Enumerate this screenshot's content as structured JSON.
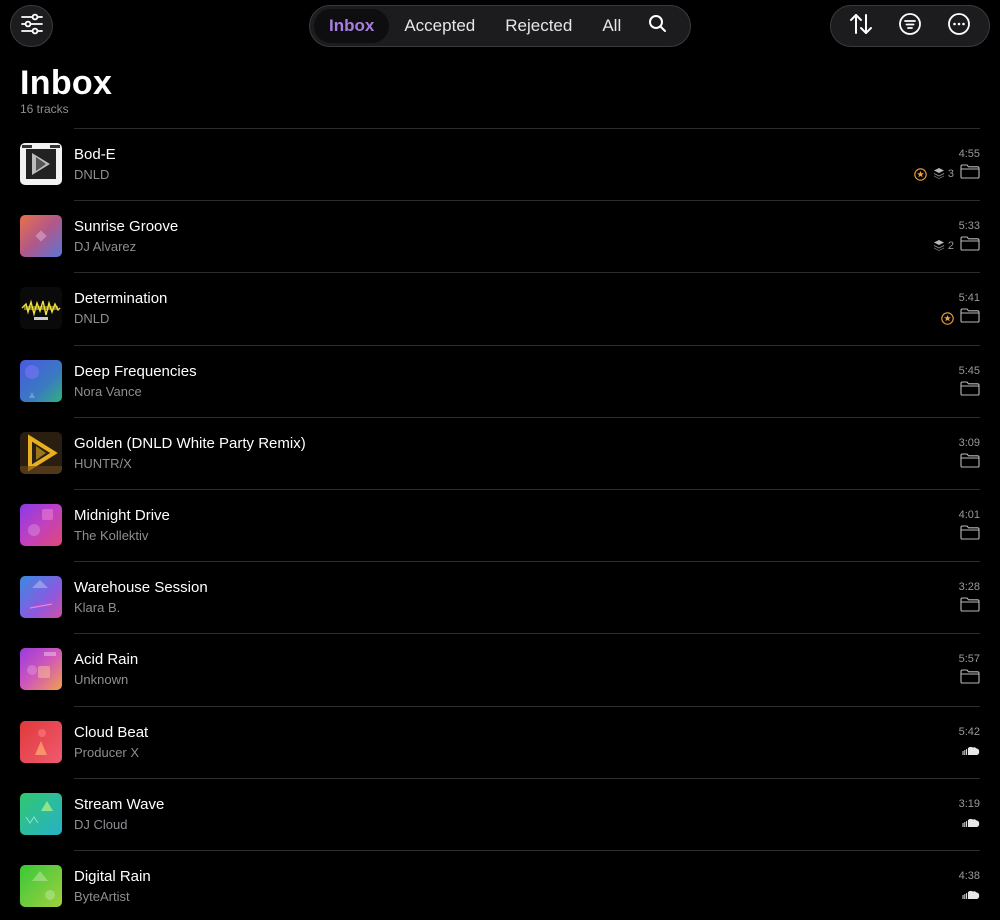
{
  "nav": {
    "tabs": [
      {
        "label": "Inbox",
        "active": true
      },
      {
        "label": "Accepted",
        "active": false
      },
      {
        "label": "Rejected",
        "active": false
      },
      {
        "label": "All",
        "active": false
      }
    ],
    "accent": "#a77ee0"
  },
  "page": {
    "title": "Inbox",
    "subtitle": "16 tracks"
  },
  "tracks": [
    {
      "title": "Bod-E",
      "artist": "DNLD",
      "duration": "4:55",
      "starred": true,
      "versions": "3",
      "source": "folder-icon",
      "art": "bode"
    },
    {
      "title": "Sunrise Groove",
      "artist": "DJ Alvarez",
      "duration": "5:33",
      "starred": false,
      "versions": "2",
      "source": "folder-icon",
      "art": "sunrise"
    },
    {
      "title": "Determination",
      "artist": "DNLD",
      "duration": "5:41",
      "starred": true,
      "versions": "",
      "source": "folder-icon",
      "art": "determination"
    },
    {
      "title": "Deep Frequencies",
      "artist": "Nora Vance",
      "duration": "5:45",
      "starred": false,
      "versions": "",
      "source": "folder-icon",
      "art": "deep"
    },
    {
      "title": "Golden (DNLD White Party Remix)",
      "artist": "HUNTR/X",
      "duration": "3:09",
      "starred": false,
      "versions": "",
      "source": "folder-icon",
      "art": "golden"
    },
    {
      "title": "Midnight Drive",
      "artist": "The Kollektiv",
      "duration": "4:01",
      "starred": false,
      "versions": "",
      "source": "folder-icon",
      "art": "midnight"
    },
    {
      "title": "Warehouse Session",
      "artist": "Klara B.",
      "duration": "3:28",
      "starred": false,
      "versions": "",
      "source": "folder-icon",
      "art": "warehouse"
    },
    {
      "title": "Acid Rain",
      "artist": "Unknown",
      "duration": "5:57",
      "starred": false,
      "versions": "",
      "source": "folder-icon",
      "art": "acid"
    },
    {
      "title": "Cloud Beat",
      "artist": "Producer X",
      "duration": "5:42",
      "starred": false,
      "versions": "",
      "source": "soundcloud-icon",
      "art": "cloud"
    },
    {
      "title": "Stream Wave",
      "artist": "DJ Cloud",
      "duration": "3:19",
      "starred": false,
      "versions": "",
      "source": "soundcloud-icon",
      "art": "stream"
    },
    {
      "title": "Digital Rain",
      "artist": "ByteArtist",
      "duration": "4:38",
      "starred": false,
      "versions": "",
      "source": "soundcloud-icon",
      "art": "digital"
    }
  ],
  "colors": {
    "star": "#f0a040",
    "muted": "#8e8e93",
    "divider": "#2c2c2e"
  }
}
